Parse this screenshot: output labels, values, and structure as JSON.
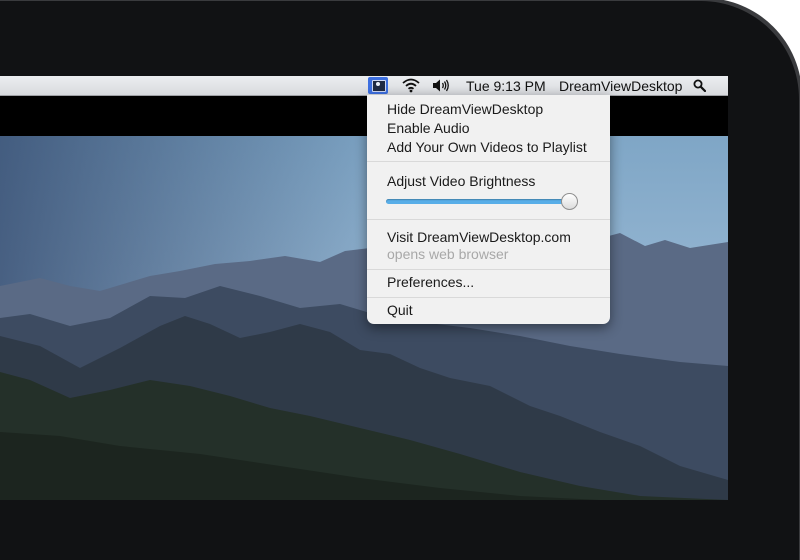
{
  "menubar": {
    "clock": "Tue 9:13 PM",
    "app_name": "DreamViewDesktop",
    "icons": [
      "dreamview-app-icon",
      "wifi-icon",
      "volume-icon",
      "spotlight-search-icon"
    ]
  },
  "menu": {
    "hide": "Hide DreamViewDesktop",
    "enable_audio": "Enable Audio",
    "add_videos": "Add Your Own Videos to Playlist",
    "brightness_label": "Adjust Video Brightness",
    "brightness_value": 0.97,
    "visit": "Visit DreamViewDesktop.com",
    "visit_note": "opens web browser",
    "preferences": "Preferences...",
    "quit": "Quit"
  },
  "colors": {
    "menubar_highlight": "#3d6fe0",
    "slider_fill": "#58aee8",
    "menu_background": "#f1f1f1"
  }
}
